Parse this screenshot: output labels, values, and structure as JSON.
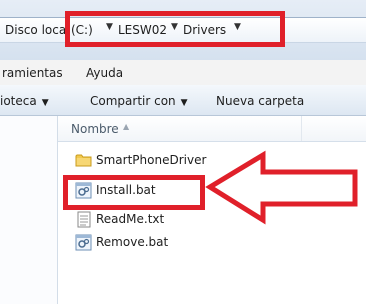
{
  "address": {
    "crumbs": [
      "Disco loca",
      "(C:)",
      "LESW02",
      "Drivers"
    ]
  },
  "menu": [
    "ramientas",
    "Ayuda"
  ],
  "commands": [
    "ioteca",
    "Compartir con",
    "Nueva carpeta"
  ],
  "columns": {
    "name": "Nombre"
  },
  "files": [
    {
      "name": "SmartPhoneDriver",
      "icon": "folder-icon"
    },
    {
      "name": "Install.bat",
      "icon": "batch-file-icon"
    },
    {
      "name": "ReadMe.txt",
      "icon": "text-file-icon"
    },
    {
      "name": "Remove.bat",
      "icon": "batch-file-icon"
    }
  ],
  "colors": {
    "annotation": "#e0202a",
    "folder": "#f2c94c"
  }
}
